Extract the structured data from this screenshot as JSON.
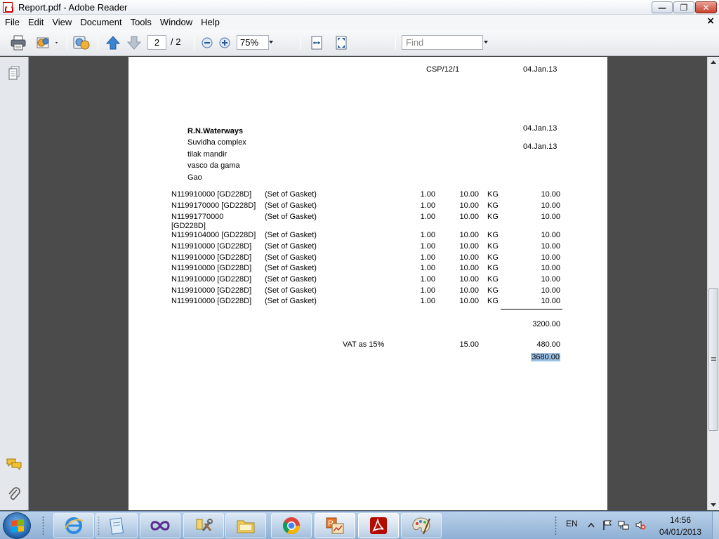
{
  "window": {
    "title": "Report.pdf - Adobe Reader",
    "minimize_glyph": "—",
    "maximize_glyph": "❐",
    "close_glyph": "✕"
  },
  "menu": {
    "items": [
      "File",
      "Edit",
      "View",
      "Document",
      "Tools",
      "Window",
      "Help"
    ],
    "close_glyph": "×"
  },
  "toolbar": {
    "page_current": "2",
    "page_total": "/ 2",
    "zoom": "75%",
    "find_placeholder": "Find"
  },
  "document": {
    "ref": "CSP/12/1",
    "date_top": "04.Jan.13",
    "address": [
      "R.N.Waterways",
      "Suvidha complex",
      "tilak mandir",
      "vasco da gama",
      "Gao"
    ],
    "date_1": "04.Jan.13",
    "date_2": "04.Jan.13",
    "rows": [
      {
        "code": "N119910000 [GD228D]",
        "desc": "(Set of Gasket)",
        "qty": "1.00",
        "rate": "10.00",
        "unit": "KG",
        "amount": "10.00"
      },
      {
        "code": "N1199170000 [GD228D]",
        "desc": "(Set of Gasket)",
        "qty": "1.00",
        "rate": "10.00",
        "unit": "KG",
        "amount": "10.00"
      },
      {
        "code": "N11991770000",
        "code2": "[GD228D]",
        "desc": "(Set of Gasket)",
        "qty": "1.00",
        "rate": "10.00",
        "unit": "KG",
        "amount": "10.00"
      },
      {
        "code": "N1199104000 [GD228D]",
        "desc": "(Set of Gasket)",
        "qty": "1.00",
        "rate": "10.00",
        "unit": "KG",
        "amount": "10.00"
      },
      {
        "code": "N119910000 [GD228D]",
        "desc": "(Set of Gasket)",
        "qty": "1.00",
        "rate": "10.00",
        "unit": "KG",
        "amount": "10.00"
      },
      {
        "code": "N119910000 [GD228D]",
        "desc": "(Set of Gasket)",
        "qty": "1.00",
        "rate": "10.00",
        "unit": "KG",
        "amount": "10.00"
      },
      {
        "code": "N119910000 [GD228D]",
        "desc": "(Set of Gasket)",
        "qty": "1.00",
        "rate": "10.00",
        "unit": "KG",
        "amount": "10.00"
      },
      {
        "code": "N119910000 [GD228D]",
        "desc": "(Set of Gasket)",
        "qty": "1.00",
        "rate": "10.00",
        "unit": "KG",
        "amount": "10.00"
      },
      {
        "code": "N119910000 [GD228D]",
        "desc": "(Set of Gasket)",
        "qty": "1.00",
        "rate": "10.00",
        "unit": "KG",
        "amount": "10.00"
      },
      {
        "code": "N119910000 [GD228D]",
        "desc": "(Set of Gasket)",
        "qty": "1.00",
        "rate": "10.00",
        "unit": "KG",
        "amount": "10.00"
      }
    ],
    "subtotal": "3200.00",
    "vat_label": "VAT as 15%",
    "vat_rate": "15.00",
    "vat_amount": "480.00",
    "total": "3680.00"
  },
  "taskbar": {
    "language": "EN",
    "time": "14:56",
    "date": "04/01/2013"
  },
  "colors": {
    "accent": "#3a6ea5",
    "highlight": "#9ec1e6",
    "acrobat_red": "#b30b00"
  }
}
